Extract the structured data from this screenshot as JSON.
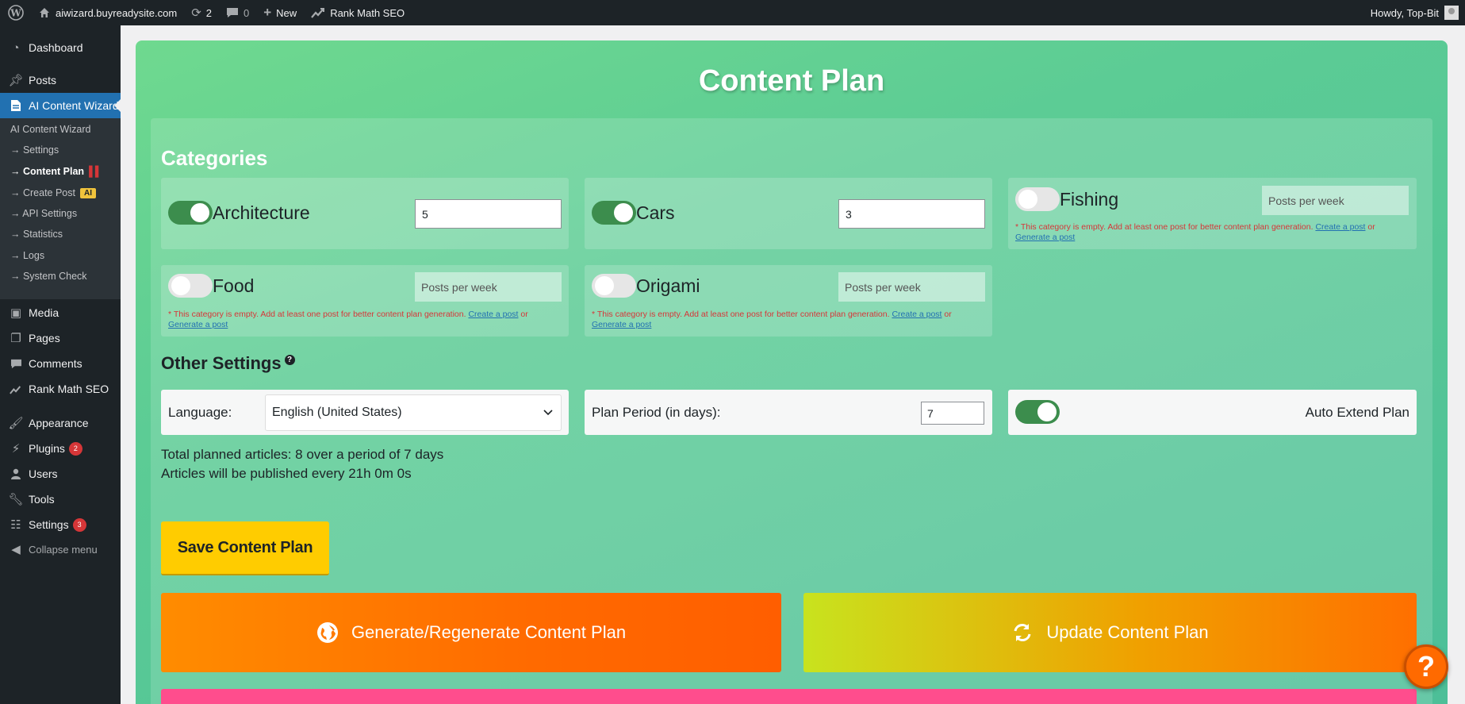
{
  "adminbar": {
    "site_name": "aiwizard.buyreadysite.com",
    "updates_count": "2",
    "comments_count": "0",
    "new_label": "New",
    "seo_label": "Rank Math SEO",
    "howdy": "Howdy, Top-Bit"
  },
  "sidebar": {
    "dashboard": "Dashboard",
    "posts": "Posts",
    "ai_wizard": "AI Content Wizard",
    "submenu": {
      "header": "AI Content Wizard",
      "settings": "→ Settings",
      "content_plan": "→ Content Plan",
      "create_post": "→ Create Post",
      "create_post_tag": "AI",
      "api_settings": "→ API Settings",
      "statistics": "→ Statistics",
      "logs": "→ Logs",
      "system_check": "→ System Check"
    },
    "media": "Media",
    "pages": "Pages",
    "comments": "Comments",
    "rank_math": "Rank Math SEO",
    "appearance": "Appearance",
    "plugins": "Plugins",
    "plugins_badge": "2",
    "users": "Users",
    "tools": "Tools",
    "settings": "Settings",
    "settings_badge": "3",
    "collapse": "Collapse menu"
  },
  "page": {
    "title": "Content Plan",
    "categories_heading": "Categories",
    "categories": [
      {
        "name": "Architecture",
        "enabled": true,
        "posts_per_week": "5"
      },
      {
        "name": "Cars",
        "enabled": true,
        "posts_per_week": "3"
      },
      {
        "name": "Fishing",
        "enabled": false,
        "posts_per_week": ""
      },
      {
        "name": "Food",
        "enabled": false,
        "posts_per_week": ""
      },
      {
        "name": "Origami",
        "enabled": false,
        "posts_per_week": ""
      }
    ],
    "posts_placeholder": "Posts per week",
    "empty_note": "* This category is empty. Add at least one post for better content plan generation.",
    "create_post_link": "Create a post",
    "or_text": "or",
    "generate_post_link": "Generate a post",
    "other_heading": "Other Settings",
    "help_mark": "?",
    "language_label": "Language:",
    "language_value": "English (United States)",
    "plan_period_label": "Plan Period (in days):",
    "plan_period_value": "7",
    "auto_extend_label": "Auto Extend Plan",
    "auto_extend_enabled": true,
    "summary_line1": "Total planned articles: 8 over a period of 7 days",
    "summary_line2": "Articles will be published every 21h 0m 0s",
    "save_button": "Save Content Plan",
    "generate_button": "Generate/Regenerate Content Plan",
    "update_button": "Update Content Plan",
    "help_fab": "?"
  },
  "icons": {
    "wordpress": "wordpress-icon",
    "home": "home-icon",
    "updates": "refresh-icon",
    "comments": "comment-icon",
    "new": "plus-icon",
    "globe": "globe-icon",
    "sync": "sync-icon"
  },
  "colors": {
    "admin_bg": "#1d2327",
    "wp_blue": "#2271b1",
    "save_yellow": "#ffcc00",
    "generate_orange": "#ff6a00",
    "toggle_on": "#3c8d4d"
  }
}
